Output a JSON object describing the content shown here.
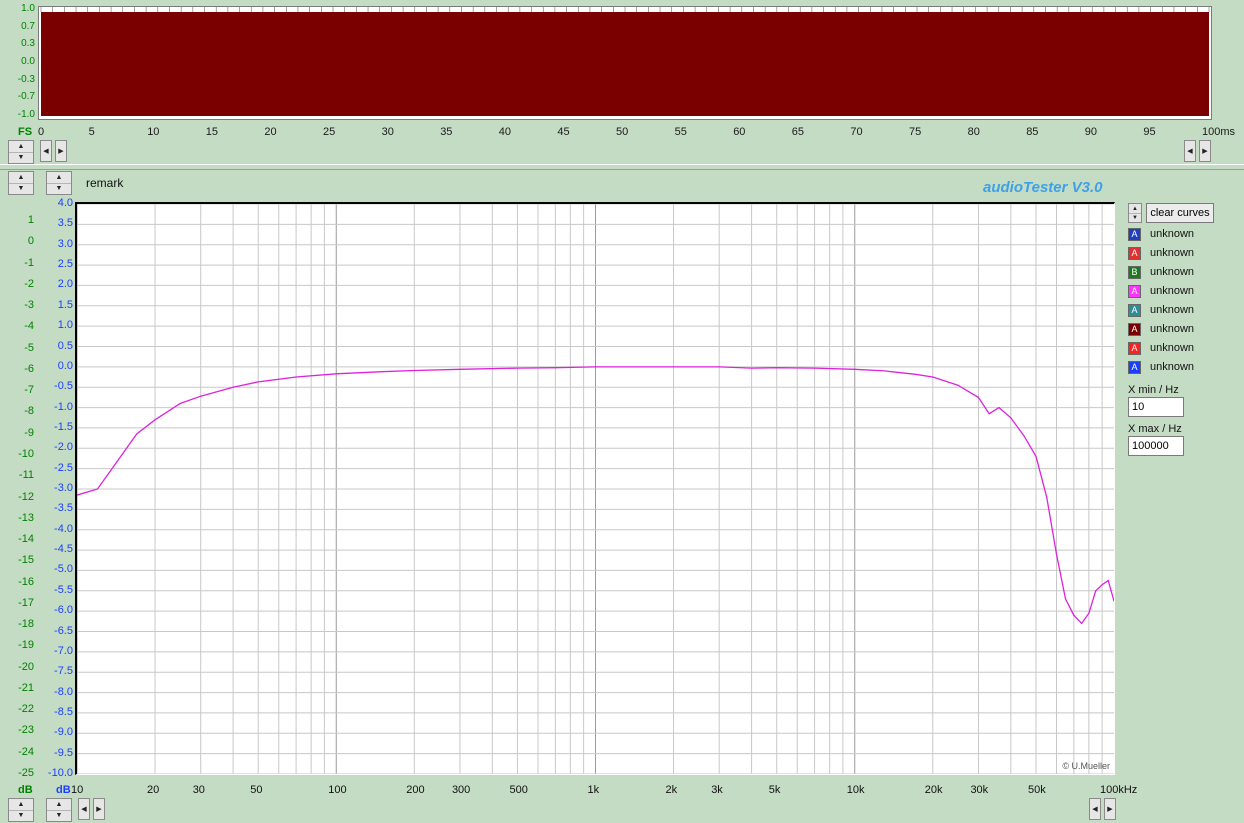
{
  "app": {
    "brand": "audioTester  V3.0",
    "copyright": "© U.Mueller",
    "remark_label": "remark"
  },
  "waveform": {
    "y_ticks": [
      "1.0",
      "0.7",
      "0.3",
      "0.0",
      "-0.3",
      "-0.7",
      "-1.0"
    ],
    "y_unit": "FS",
    "x_ticks": [
      "0",
      "5",
      "10",
      "15",
      "20",
      "25",
      "30",
      "35",
      "40",
      "45",
      "50",
      "55",
      "60",
      "65",
      "70",
      "75",
      "80",
      "85",
      "90",
      "95",
      "100ms"
    ],
    "fill_color": "#7a0000"
  },
  "controls": {
    "clear_curves": "clear curves",
    "xmin_label": "X min / Hz",
    "xmin_value": "10",
    "xmax_label": "X max / Hz",
    "xmax_value": "100000"
  },
  "legend": [
    {
      "badge": "A",
      "label": "unknown",
      "color": "#1e3fbf"
    },
    {
      "badge": "A",
      "label": "unknown",
      "color": "#e03030"
    },
    {
      "badge": "B",
      "label": "unknown",
      "color": "#1d7a1d"
    },
    {
      "badge": "A",
      "label": "unknown",
      "color": "#ff33ff"
    },
    {
      "badge": "A",
      "label": "unknown",
      "color": "#2e8e96"
    },
    {
      "badge": "A",
      "label": "unknown",
      "color": "#7a0000"
    },
    {
      "badge": "A",
      "label": "unknown",
      "color": "#ff2020"
    },
    {
      "badge": "A",
      "label": "unknown",
      "color": "#1a3fff"
    }
  ],
  "chart_data": {
    "type": "line",
    "xscale": "log",
    "xlim": [
      10,
      100000
    ],
    "ylim": [
      -10,
      4
    ],
    "x_tick_labels": [
      "10",
      "20",
      "30",
      "50",
      "100",
      "200",
      "300",
      "500",
      "1k",
      "2k",
      "3k",
      "5k",
      "10k",
      "20k",
      "30k",
      "50k",
      "100kHz"
    ],
    "x_tick_values": [
      10,
      20,
      30,
      50,
      100,
      200,
      300,
      500,
      1000,
      2000,
      3000,
      5000,
      10000,
      20000,
      30000,
      50000,
      100000
    ],
    "y_tick_labels_blue": [
      "4.0",
      "3.5",
      "3.0",
      "2.5",
      "2.0",
      "1.5",
      "1.0",
      "0.5",
      "0.0",
      "-0.5",
      "-1.0",
      "-1.5",
      "-2.0",
      "-2.5",
      "-3.0",
      "-3.5",
      "-4.0",
      "-4.5",
      "-5.0",
      "-5.5",
      "-6.0",
      "-6.5",
      "-7.0",
      "-7.5",
      "-8.0",
      "-8.5",
      "-9.0",
      "-9.5",
      "-10.0"
    ],
    "y_tick_labels_green": [
      "1",
      "0",
      "-1",
      "-2",
      "-3",
      "-4",
      "-5",
      "-6",
      "-7",
      "-8",
      "-9",
      "-10",
      "-11",
      "-12",
      "-13",
      "-14",
      "-15",
      "-16",
      "-17",
      "-18",
      "-19",
      "-20",
      "-21",
      "-22",
      "-23",
      "-24",
      "-25"
    ],
    "y_unit_green": "dB",
    "y_unit_blue": "dB",
    "grid": true,
    "series": [
      {
        "color": "#dd22dd",
        "x": [
          10,
          12,
          14,
          17,
          20,
          25,
          30,
          40,
          50,
          70,
          100,
          150,
          200,
          300,
          500,
          700,
          1000,
          2000,
          3000,
          4000,
          5000,
          7000,
          10000,
          13000,
          17000,
          20000,
          25000,
          30000,
          33000,
          36000,
          40000,
          45000,
          50000,
          55000,
          60000,
          65000,
          70000,
          75000,
          80000,
          85000,
          90000,
          95000,
          100000
        ],
        "y": [
          -3.15,
          -3.0,
          -2.4,
          -1.65,
          -1.3,
          -0.9,
          -0.72,
          -0.5,
          -0.37,
          -0.25,
          -0.17,
          -0.12,
          -0.09,
          -0.06,
          -0.03,
          -0.02,
          0.0,
          0.0,
          0.0,
          -0.03,
          -0.02,
          -0.03,
          -0.06,
          -0.1,
          -0.18,
          -0.25,
          -0.45,
          -0.75,
          -1.15,
          -1.0,
          -1.25,
          -1.7,
          -2.2,
          -3.2,
          -4.6,
          -5.7,
          -6.1,
          -6.3,
          -6.05,
          -5.5,
          -5.35,
          -5.25,
          -5.75
        ]
      }
    ]
  }
}
